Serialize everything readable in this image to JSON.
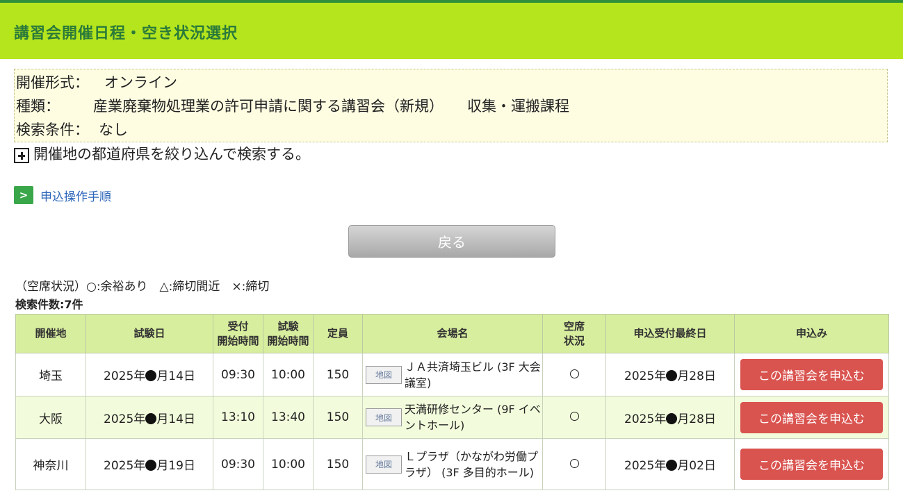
{
  "header": {
    "title": "講習会開催日程・空き状況選択"
  },
  "info": {
    "format_label": "開催形式：",
    "format_value": "オンライン",
    "type_label": "種類：",
    "type_value": "産業廃棄物処理業の許可申請に関する講習会（新規）",
    "type_course": "収集・運搬課程",
    "search_label": "検索条件：",
    "search_value": "なし"
  },
  "filter": {
    "label": "開催地の都道府県を絞り込んで検索する。"
  },
  "guide": {
    "arrow": ">",
    "link": "申込操作手順"
  },
  "back_button": "戻る",
  "legend": "（空席状況）○:余裕あり　△:締切間近　×:締切",
  "count": "検索件数:7件",
  "table": {
    "headers": {
      "location": "開催地",
      "exam_date": "試験日",
      "reception_1": "受付",
      "reception_2": "開始時間",
      "exam_1": "試験",
      "exam_2": "開始時間",
      "capacity": "定員",
      "venue": "会場名",
      "seats_1": "空席",
      "seats_2": "状況",
      "deadline": "申込受付最終日",
      "apply": "申込み"
    },
    "map_label": "地図",
    "apply_label": "この講習会を申込む",
    "rows": [
      {
        "location": "埼玉",
        "exam_date_pre": "2025年",
        "exam_date_post": "月14日",
        "reception": "09:30",
        "exam_start": "10:00",
        "capacity": "150",
        "venue": "ＪＡ共済埼玉ビル (3F 大会議室)",
        "seats": "○",
        "deadline_pre": "2025年",
        "deadline_post": "月28日"
      },
      {
        "location": "大阪",
        "exam_date_pre": "2025年",
        "exam_date_post": "月14日",
        "reception": "13:10",
        "exam_start": "13:40",
        "capacity": "150",
        "venue": "天満研修センター (9F イベントホール)",
        "seats": "○",
        "deadline_pre": "2025年",
        "deadline_post": "月28日"
      },
      {
        "location": "神奈川",
        "exam_date_pre": "2025年",
        "exam_date_post": "月19日",
        "reception": "09:30",
        "exam_start": "10:00",
        "capacity": "150",
        "venue": "Ｌプラザ（かながわ労働プラザ） (3F 多目的ホール)",
        "seats": "○",
        "deadline_pre": "2025年",
        "deadline_post": "月02日"
      }
    ]
  }
}
